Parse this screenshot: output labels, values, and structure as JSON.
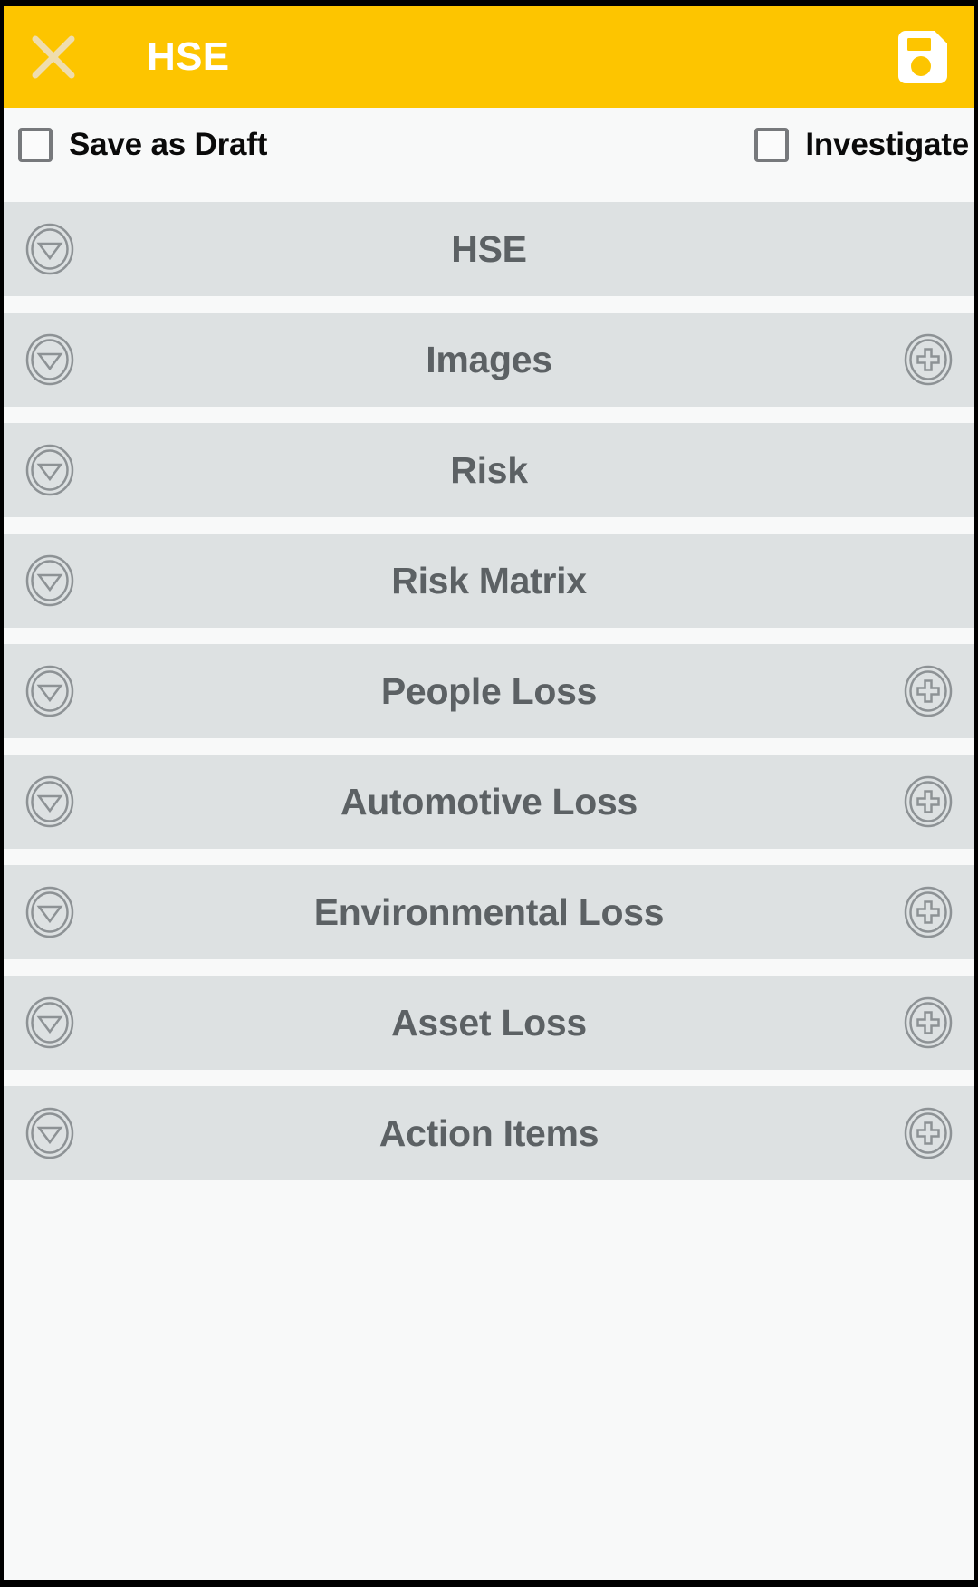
{
  "theme": {
    "accent_yellow": "#fdc500",
    "row_background": "#dde1e2",
    "page_background": "#f8f9f9",
    "row_text": "#5c6164",
    "icon_stroke": "#808587",
    "checkbox_border": "#77797c"
  },
  "appbar": {
    "title": "HSE",
    "close_icon": "close-x-icon",
    "save_icon": "save-floppy-disk-icon"
  },
  "options": {
    "save_as_draft": {
      "label": "Save as Draft",
      "checked": false
    },
    "investigate": {
      "label": "Investigate",
      "checked": false
    }
  },
  "sections": [
    {
      "label": "HSE",
      "toggle_icon": "chevron-down-circle-icon",
      "has_add": false,
      "add_icon": null
    },
    {
      "label": "Images",
      "toggle_icon": "chevron-down-circle-icon",
      "has_add": true,
      "add_icon": "plus-circle-icon"
    },
    {
      "label": "Risk",
      "toggle_icon": "chevron-down-circle-icon",
      "has_add": false,
      "add_icon": null
    },
    {
      "label": "Risk Matrix",
      "toggle_icon": "chevron-down-circle-icon",
      "has_add": false,
      "add_icon": null
    },
    {
      "label": "People Loss",
      "toggle_icon": "chevron-down-circle-icon",
      "has_add": true,
      "add_icon": "plus-circle-icon"
    },
    {
      "label": "Automotive Loss",
      "toggle_icon": "chevron-down-circle-icon",
      "has_add": true,
      "add_icon": "plus-circle-icon"
    },
    {
      "label": "Environmental Loss",
      "toggle_icon": "chevron-down-circle-icon",
      "has_add": true,
      "add_icon": "plus-circle-icon"
    },
    {
      "label": "Asset Loss",
      "toggle_icon": "chevron-down-circle-icon",
      "has_add": true,
      "add_icon": "plus-circle-icon"
    },
    {
      "label": "Action Items",
      "toggle_icon": "chevron-down-circle-icon",
      "has_add": true,
      "add_icon": "plus-circle-icon"
    }
  ]
}
